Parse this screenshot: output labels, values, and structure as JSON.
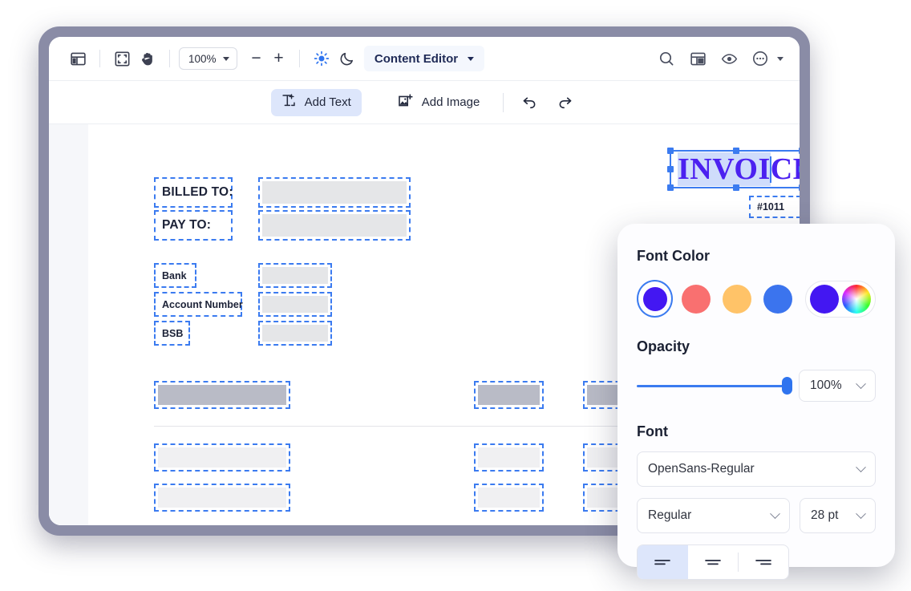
{
  "window": {
    "toolbar": {
      "layout_icon": "panel-layout-icon",
      "fit_icon": "fit-screen-icon",
      "hand_icon": "hand-tool-icon",
      "zoom_value": "100%",
      "zoom_out_label": "−",
      "zoom_in_label": "+",
      "brightness_icon": "sun-icon",
      "dark_mode_icon": "moon-icon",
      "mode_label": "Content Editor",
      "search_icon": "search-icon",
      "panel_icon": "panel-layout-icon",
      "preview_icon": "eye-icon",
      "more_icon": "more-options-icon"
    },
    "actions": {
      "add_text_label": "Add Text",
      "add_image_label": "Add Image",
      "undo_icon": "undo-icon",
      "redo_icon": "redo-icon"
    }
  },
  "document": {
    "title_text": "INVOICE",
    "title_selected_part": "INVOI",
    "title_unselected_part": "CE",
    "invoice_number": "#1011",
    "fields": [
      {
        "label": "BILLED TO:"
      },
      {
        "label": "PAY TO:"
      },
      {
        "label": "Bank"
      },
      {
        "label": "Account Number"
      },
      {
        "label": "BSB"
      }
    ]
  },
  "font_panel": {
    "font_color_heading": "Font Color",
    "swatches": [
      {
        "name": "violet",
        "hex": "#4317f2",
        "selected": true
      },
      {
        "name": "coral",
        "hex": "#f97070",
        "selected": false
      },
      {
        "name": "amber",
        "hex": "#ffc368",
        "selected": false
      },
      {
        "name": "blue",
        "hex": "#3b74ee",
        "selected": false
      }
    ],
    "current_color": "#4317f2",
    "color_wheel_icon": "color-wheel-icon",
    "opacity_heading": "Opacity",
    "opacity_value": "100%",
    "opacity_percent": 100,
    "font_heading": "Font",
    "font_family": "OpenSans-Regular",
    "font_style": "Regular",
    "font_size": "28 pt",
    "alignment": {
      "left_icon": "align-left-icon",
      "center_icon": "align-center-icon",
      "right_icon": "align-right-icon",
      "selected": "left"
    }
  }
}
